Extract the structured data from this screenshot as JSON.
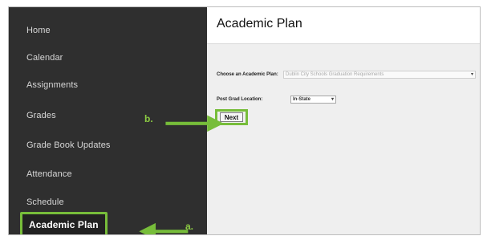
{
  "sidebar": {
    "items": [
      {
        "label": "Home"
      },
      {
        "label": "Calendar"
      },
      {
        "label": "Assignments"
      },
      {
        "label": "Grades"
      },
      {
        "label": "Grade Book Updates"
      },
      {
        "label": "Attendance"
      },
      {
        "label": "Schedule"
      },
      {
        "label": "Academic Plan"
      }
    ]
  },
  "main": {
    "title": "Academic Plan",
    "choose_plan": {
      "label": "Choose an Academic Plan:",
      "value": "Dublin City Schools Graduation Requirements"
    },
    "post_grad": {
      "label": "Post Grad Location:",
      "value": "In-State"
    },
    "next_label": "Next"
  },
  "annotations": {
    "b": "b.",
    "a": "a."
  },
  "colors": {
    "sidebar_bg": "#2f2f2f",
    "annotation_green": "#77bd3a",
    "main_bg": "#efefef"
  }
}
